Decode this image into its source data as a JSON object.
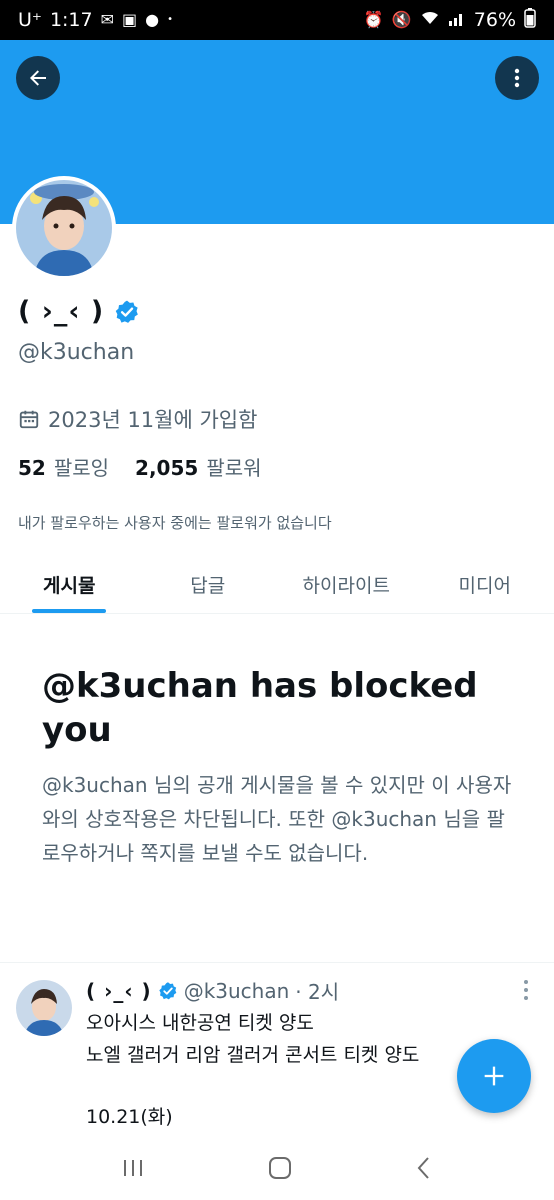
{
  "status_bar": {
    "carrier": "U⁺",
    "time": "1:17",
    "battery": "76%"
  },
  "profile": {
    "display_name": "( ›_‹ )",
    "handle": "@k3uchan",
    "joined": "2023년 11월에 가입함",
    "following_count": "52",
    "following_label": "팔로잉",
    "followers_count": "2,055",
    "followers_label": "팔로워",
    "no_followers_note": "내가 팔로우하는 사용자 중에는 팔로워가 없습니다"
  },
  "tabs": [
    {
      "label": "게시물",
      "active": true
    },
    {
      "label": "답글",
      "active": false
    },
    {
      "label": "하이라이트",
      "active": false
    },
    {
      "label": "미디어",
      "active": false
    }
  ],
  "blocked": {
    "title": "@k3uchan has blocked you",
    "body": "@k3uchan 님의 공개 게시물을 볼 수 있지만 이 사용자와의 상호작용은 차단됩니다. 또한 @k3uchan 님을 팔로우하거나 쪽지를 보낼 수도 없습니다."
  },
  "tweet": {
    "name": "( ›_‹ )",
    "handle": "@k3uchan",
    "time": "· 2시",
    "line1": "오아시스 내한공연 티켓 양도",
    "line2": "노엘 갤러거 리암 갤러거 콘서트 티켓 양도",
    "line3": "10.21(화)"
  },
  "colors": {
    "accent": "#1d9bf0",
    "text": "#0f1419",
    "muted": "#536471"
  },
  "icons": {
    "back": "arrow-left-icon",
    "more": "more-vertical-icon",
    "verified": "verified-badge-icon",
    "calendar": "calendar-icon",
    "compose": "plus-icon"
  }
}
